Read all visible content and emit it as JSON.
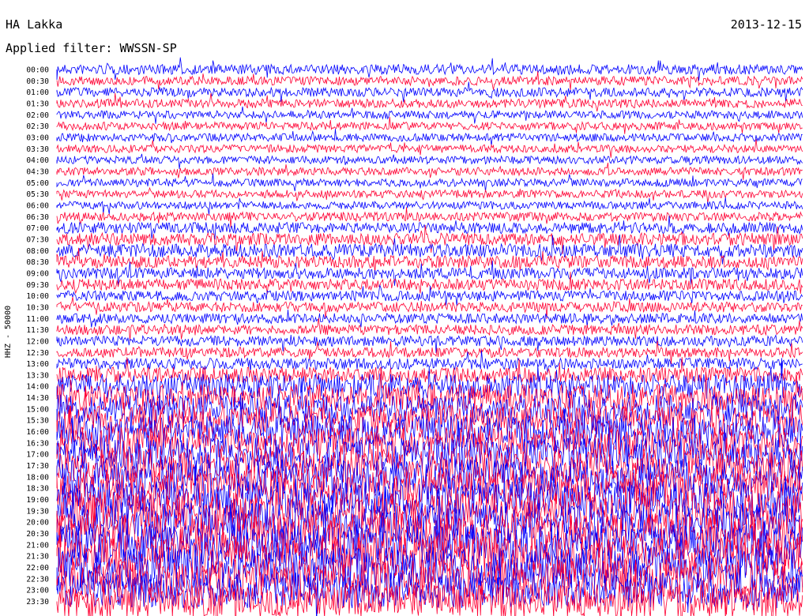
{
  "header": {
    "station": "HA Lakka",
    "date": "2013-12-15",
    "filter": "Applied filter: WWSSN-SP"
  },
  "chart_data": {
    "type": "line",
    "title": "HA Lakka",
    "ylabel": "HHZ - 50000",
    "grid": false,
    "legend": "none",
    "colors": [
      "#0000ff",
      "#ff0033"
    ],
    "row_labels": [
      "00:00",
      "00:30",
      "01:00",
      "01:30",
      "02:00",
      "02:30",
      "03:00",
      "03:30",
      "04:00",
      "04:30",
      "05:00",
      "05:30",
      "06:00",
      "06:30",
      "07:00",
      "07:30",
      "08:00",
      "08:30",
      "09:00",
      "09:30",
      "10:00",
      "10:30",
      "11:00",
      "11:30",
      "12:00",
      "12:30",
      "13:00",
      "13:30",
      "14:00",
      "14:30",
      "15:00",
      "15:30",
      "16:00",
      "16:30",
      "17:00",
      "17:30",
      "18:00",
      "18:30",
      "19:00",
      "19:30",
      "20:00",
      "20:30",
      "21:00",
      "21:30",
      "22:00",
      "22:30",
      "23:00",
      "23:30"
    ],
    "amplitude": [
      0.45,
      0.4,
      0.4,
      0.4,
      0.35,
      0.35,
      0.35,
      0.35,
      0.35,
      0.35,
      0.35,
      0.35,
      0.35,
      0.4,
      0.5,
      0.55,
      0.6,
      0.55,
      0.5,
      0.5,
      0.45,
      0.45,
      0.45,
      0.45,
      0.45,
      0.45,
      0.5,
      0.7,
      1.1,
      1.2,
      1.3,
      1.35,
      1.4,
      1.4,
      1.45,
      1.5,
      1.55,
      1.6,
      1.6,
      1.7,
      1.75,
      1.8,
      1.8,
      1.8,
      1.8,
      1.7,
      1.6,
      1.5
    ]
  }
}
